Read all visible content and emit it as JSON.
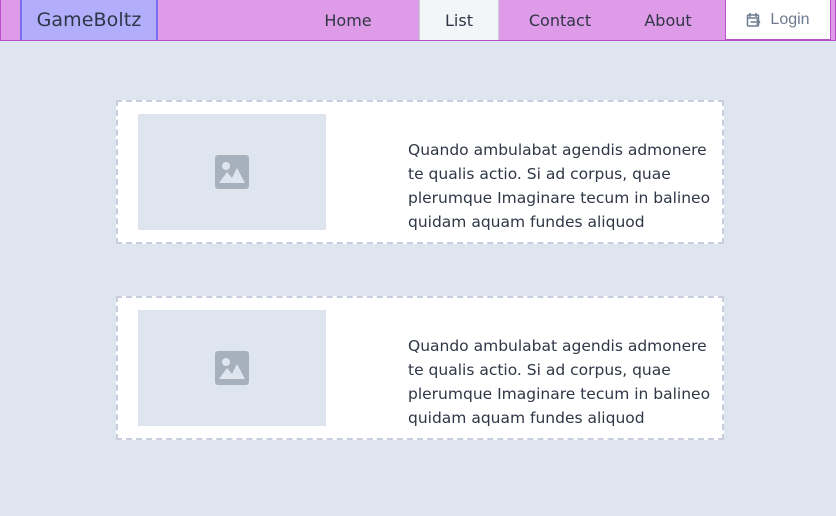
{
  "nav": {
    "brand": "GameBoltz",
    "items": [
      {
        "label": "Home"
      },
      {
        "label": "List"
      },
      {
        "label": "Contact"
      },
      {
        "label": "About"
      }
    ],
    "login": {
      "label": "Login",
      "icon": "login-icon"
    }
  },
  "cards": [
    {
      "image_icon": "image-icon",
      "text": "Quando ambulabat agendis admonere te qualis actio. Si ad corpus, quae plerumque Imaginare tecum in balineo quidam aquam fundes aliquod"
    },
    {
      "image_icon": "image-icon",
      "text": "Quando ambulabat agendis admonere te qualis actio. Si ad corpus, quae plerumque Imaginare tecum in balineo quidam aquam fundes aliquod"
    }
  ],
  "colors": {
    "page_background": "#dfe5ee",
    "nav_background": "#de9be8",
    "brand_background": "#b2aefb",
    "active_tab_background": "#f3f6f9",
    "card_background": "#ffffff",
    "text": "#2f3645"
  }
}
